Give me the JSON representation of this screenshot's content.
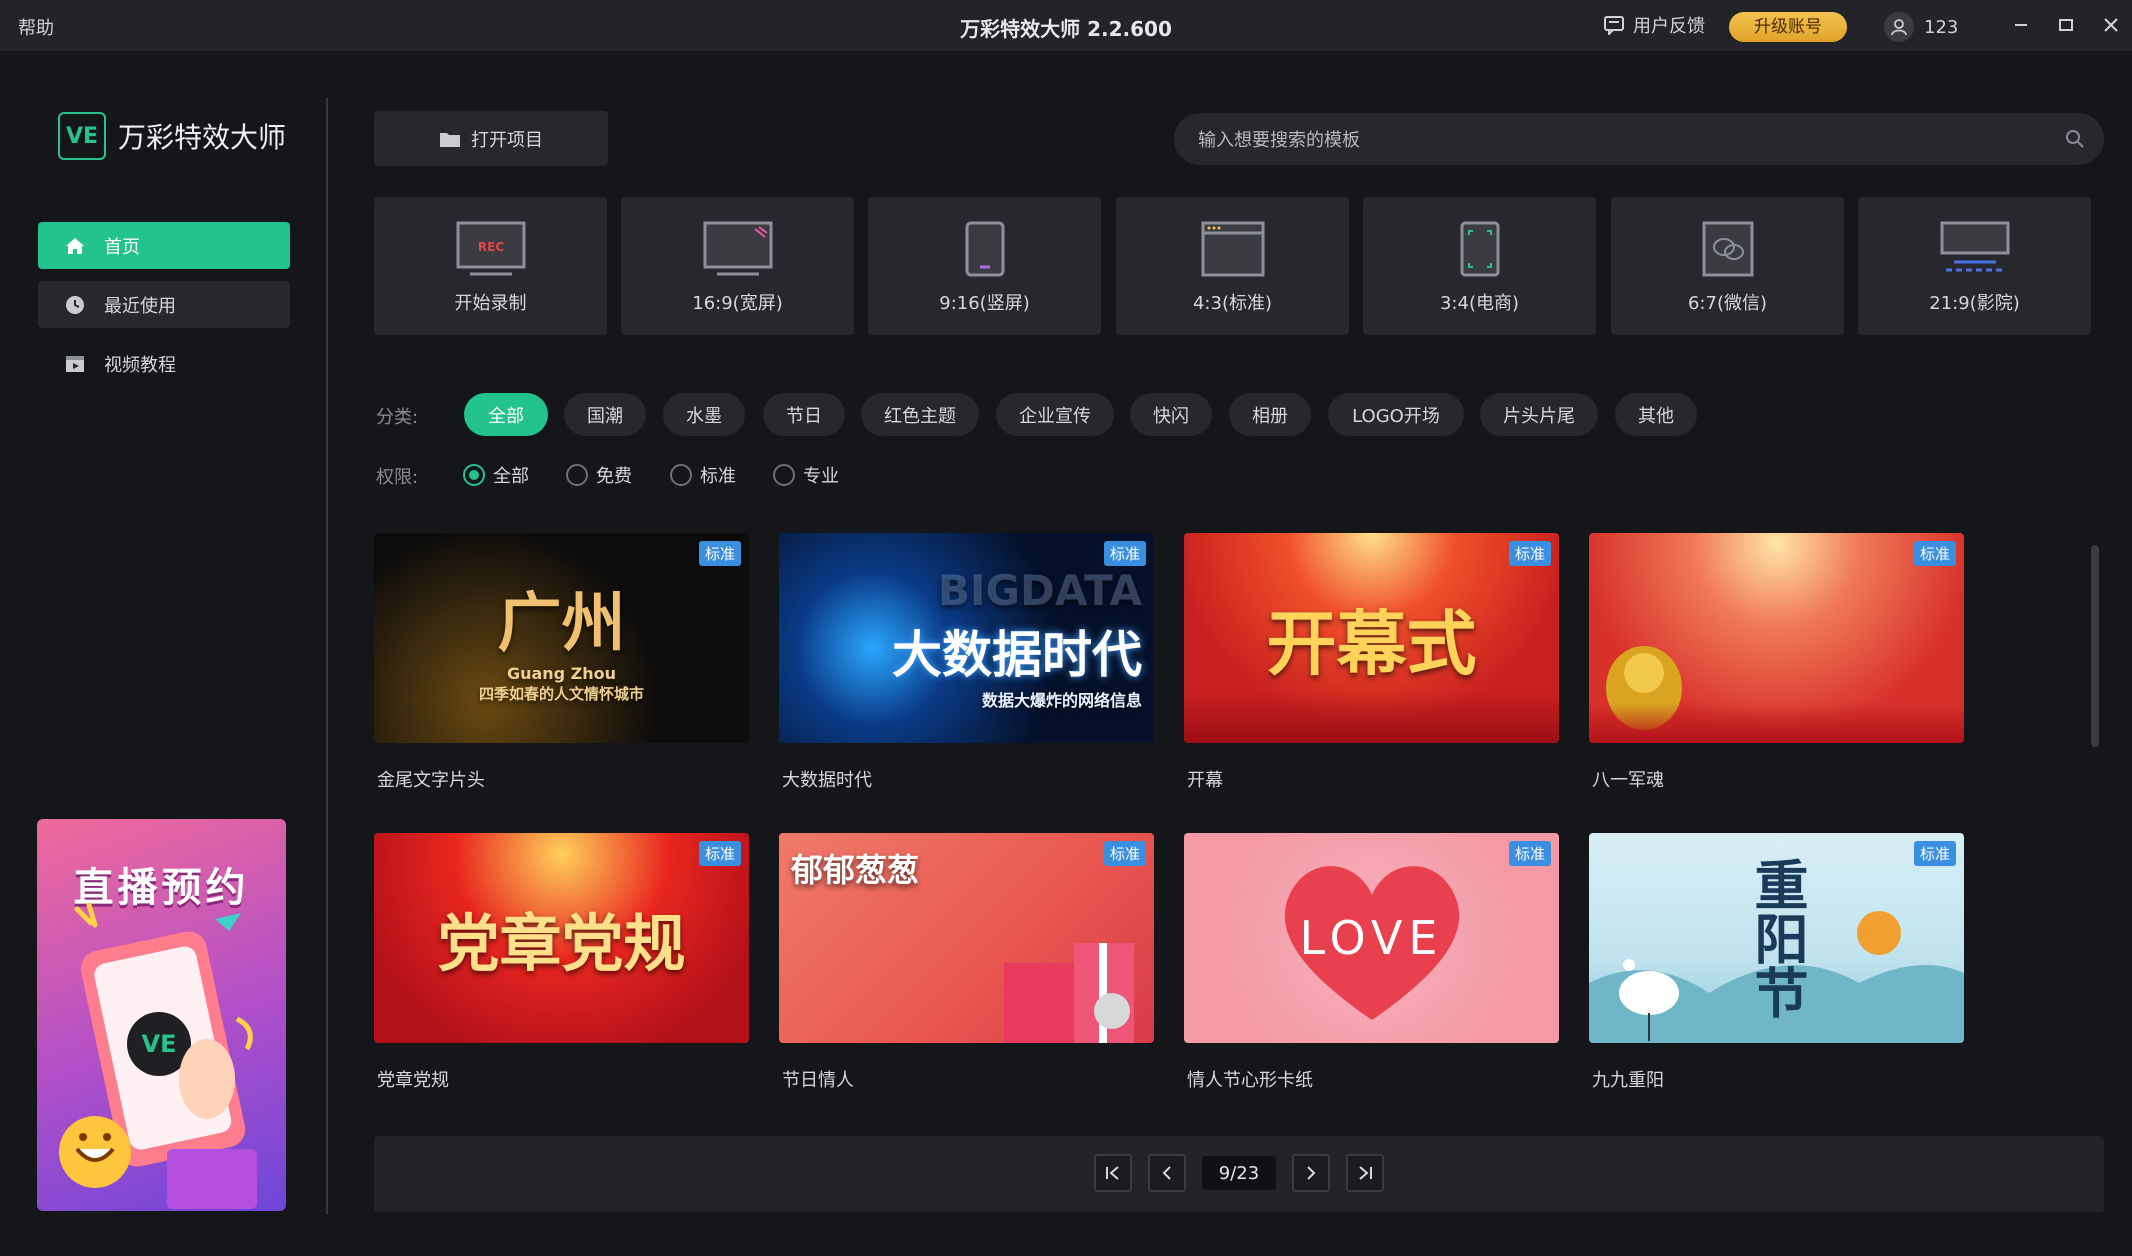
{
  "titlebar": {
    "help": "帮助",
    "title": "万彩特效大师 2.2.600",
    "feedback": "用户反馈",
    "upgrade": "升级账号",
    "user": "123"
  },
  "sidebar": {
    "logo_badge": "VE",
    "logo_text": "万彩特效大师",
    "items": [
      {
        "label": "首页",
        "icon": "home-icon"
      },
      {
        "label": "最近使用",
        "icon": "clock-icon"
      },
      {
        "label": "视频教程",
        "icon": "video-icon"
      }
    ],
    "promo_title": "直播预约",
    "promo_badge": "VE"
  },
  "toolbar": {
    "open_project": "打开项目",
    "search_placeholder": "输入想要搜索的模板"
  },
  "tiles": [
    {
      "label": "开始录制",
      "icon": "rec-icon",
      "icon_text": "REC"
    },
    {
      "label": "16:9(宽屏)",
      "icon": "widescreen-icon"
    },
    {
      "label": "9:16(竖屏)",
      "icon": "portrait-icon"
    },
    {
      "label": "4:3(标准)",
      "icon": "standard-icon"
    },
    {
      "label": "3:4(电商)",
      "icon": "ecommerce-icon"
    },
    {
      "label": "6:7(微信)",
      "icon": "wechat-icon"
    },
    {
      "label": "21:9(影院)",
      "icon": "cinema-icon"
    }
  ],
  "filters": {
    "category_label": "分类:",
    "categories": [
      "全部",
      "国潮",
      "水墨",
      "节日",
      "红色主题",
      "企业宣传",
      "快闪",
      "相册",
      "LOGO开场",
      "片头片尾",
      "其他"
    ],
    "active_category": "全部",
    "permission_label": "权限:",
    "permissions": [
      "全部",
      "免费",
      "标准",
      "专业"
    ],
    "active_permission": "全部"
  },
  "templates": [
    {
      "name": "金尾文字片头",
      "badge": "标准",
      "art": "广州",
      "art_sub": "Guang Zhou",
      "art_sub2": "四季如春的人文情怀城市",
      "bg": "#0d0c0c"
    },
    {
      "name": "大数据时代",
      "badge": "标准",
      "art": "大数据时代",
      "art_sub": "BIGDATA",
      "art_sub2": "数据大爆炸的网络信息",
      "bg": "#05112a"
    },
    {
      "name": "开幕",
      "badge": "标准",
      "art": "开幕式",
      "art_sub": "",
      "art_sub2": "",
      "bg": "#c81f1f"
    },
    {
      "name": "八一军魂",
      "badge": "标准",
      "art": "",
      "art_sub": "",
      "art_sub2": "",
      "bg": "#d8312a"
    },
    {
      "name": "党章党规",
      "badge": "标准",
      "art": "党章党规",
      "art_sub": "",
      "art_sub2": "",
      "bg": "#c8151a"
    },
    {
      "name": "节日情人",
      "badge": "标准",
      "art": "郁郁葱葱",
      "art_sub": "",
      "art_sub2": "",
      "bg": "#e8564f"
    },
    {
      "name": "情人节心形卡纸",
      "badge": "标准",
      "art": "LOVE",
      "art_sub": "",
      "art_sub2": "",
      "bg": "#f39aa6"
    },
    {
      "name": "九九重阳",
      "badge": "标准",
      "art": "重阳节",
      "art_sub": "",
      "art_sub2": "",
      "bg": "#bfe3ee"
    }
  ],
  "pagination": {
    "current": "9/23"
  }
}
